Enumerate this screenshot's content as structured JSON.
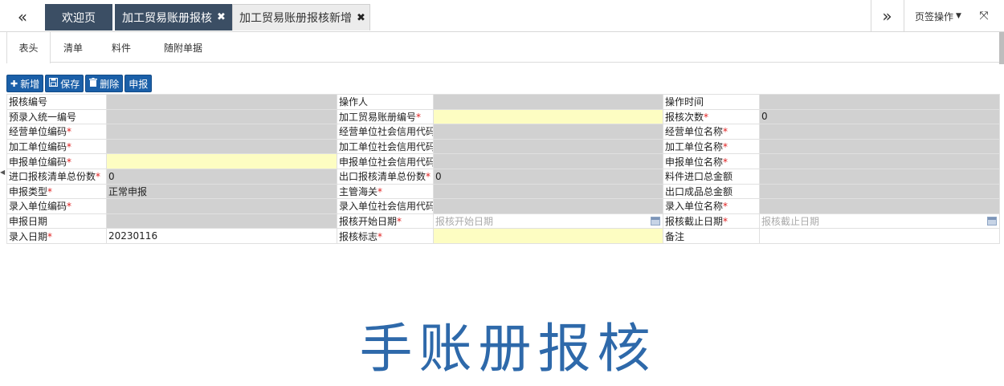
{
  "tabs": {
    "welcome": "欢迎页",
    "tab1": {
      "label": "加工贸易账册报核",
      "close": "✖"
    },
    "tab2": {
      "label": "加工贸易账册报核新增",
      "close": "✖"
    }
  },
  "nav": {
    "back": "«",
    "forward": "»",
    "page_ops": "页签操作",
    "fullscreen": "⤧"
  },
  "subtabs": [
    "表头",
    "清单",
    "料件",
    "随附单据"
  ],
  "toolbar": {
    "add": "新增",
    "save": "保存",
    "delete": "删除",
    "declare": "申报"
  },
  "form": {
    "rows": [
      [
        {
          "label": "报核编号",
          "req": false,
          "value": "",
          "style": "gray"
        },
        {
          "label": "操作人",
          "req": false,
          "value": "",
          "style": "gray"
        },
        {
          "label": "操作时间",
          "req": false,
          "value": "",
          "style": "gray"
        }
      ],
      [
        {
          "label": "预录入统一编号",
          "req": false,
          "value": "",
          "style": "gray"
        },
        {
          "label": "加工贸易账册编号",
          "req": true,
          "value": "",
          "style": "yellow"
        },
        {
          "label": "报核次数",
          "req": true,
          "value": "0",
          "style": "gray"
        }
      ],
      [
        {
          "label": "经营单位编码",
          "req": true,
          "value": "",
          "style": "gray"
        },
        {
          "label": "经营单位社会信用代码",
          "req": false,
          "value": "",
          "style": "gray"
        },
        {
          "label": "经营单位名称",
          "req": true,
          "value": "",
          "style": "gray"
        }
      ],
      [
        {
          "label": "加工单位编码",
          "req": true,
          "value": "",
          "style": "gray"
        },
        {
          "label": "加工单位社会信用代码",
          "req": false,
          "value": "",
          "style": "gray"
        },
        {
          "label": "加工单位名称",
          "req": true,
          "value": "",
          "style": "gray"
        }
      ],
      [
        {
          "label": "申报单位编码",
          "req": true,
          "value": "",
          "style": "yellow"
        },
        {
          "label": "申报单位社会信用代码",
          "req": false,
          "value": "",
          "style": "gray"
        },
        {
          "label": "申报单位名称",
          "req": true,
          "value": "",
          "style": "gray"
        }
      ],
      [
        {
          "label": "进口报核清单总份数",
          "req": true,
          "value": "0",
          "style": "gray"
        },
        {
          "label": "出口报核清单总份数",
          "req": true,
          "value": "0",
          "style": "gray"
        },
        {
          "label": "料件进口总金额",
          "req": false,
          "value": "",
          "style": "gray"
        }
      ],
      [
        {
          "label": "申报类型",
          "req": true,
          "value": "正常申报",
          "style": "gray"
        },
        {
          "label": "主管海关",
          "req": true,
          "value": "",
          "style": "gray"
        },
        {
          "label": "出口成品总金额",
          "req": false,
          "value": "",
          "style": "gray"
        }
      ],
      [
        {
          "label": "录入单位编码",
          "req": true,
          "value": "",
          "style": "gray"
        },
        {
          "label": "录入单位社会信用代码",
          "req": false,
          "value": "",
          "style": "gray"
        },
        {
          "label": "录入单位名称",
          "req": true,
          "value": "",
          "style": "gray"
        }
      ],
      [
        {
          "label": "申报日期",
          "req": false,
          "value": "",
          "style": "gray"
        },
        {
          "label": "报核开始日期",
          "req": true,
          "value": "报核开始日期",
          "style": "date"
        },
        {
          "label": "报核截止日期",
          "req": true,
          "value": "报核截止日期",
          "style": "date"
        }
      ],
      [
        {
          "label": "录入日期",
          "req": true,
          "value": "20230116",
          "style": "white"
        },
        {
          "label": "报核标志",
          "req": true,
          "value": "",
          "style": "yellow"
        },
        {
          "label": "备注",
          "req": false,
          "value": "",
          "style": "white"
        }
      ]
    ]
  },
  "banner": "手账册报核",
  "colors": {
    "accent": "#1a5fa8",
    "tab_dark": "#3b4e64",
    "banner": "#2e69aa",
    "readonly": "#d1d1d1",
    "required_field": "#fdfdc2"
  }
}
